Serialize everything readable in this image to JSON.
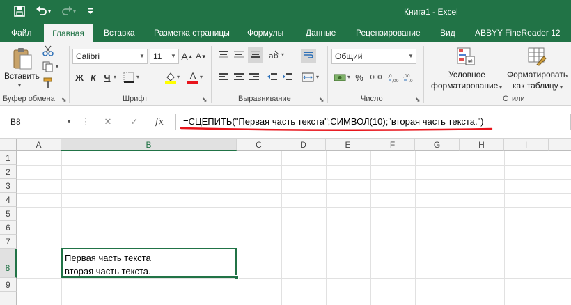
{
  "window": {
    "title": "Книга1 - Excel"
  },
  "quick_access": {
    "save_icon": "💾",
    "undo_icon": "↶",
    "redo_icon": "↷",
    "customize_icon": "▾"
  },
  "tabs": [
    {
      "label": "Файл"
    },
    {
      "label": "Главная",
      "active": true
    },
    {
      "label": "Вставка"
    },
    {
      "label": "Разметка страницы"
    },
    {
      "label": "Формулы"
    },
    {
      "label": "Данные"
    },
    {
      "label": "Рецензирование"
    },
    {
      "label": "Вид"
    },
    {
      "label": "ABBYY FineReader 12"
    }
  ],
  "ribbon": {
    "clipboard": {
      "label": "Буфер обмена",
      "paste_label": "Вставить"
    },
    "font": {
      "label": "Шрифт",
      "font_name": "Calibri",
      "font_size": "11",
      "bold": "Ж",
      "italic": "К",
      "underline": "Ч",
      "grow": "A",
      "shrink": "A",
      "font_color_letter": "A"
    },
    "alignment": {
      "label": "Выравнивание"
    },
    "number": {
      "label": "Число",
      "format": "Общий",
      "percent": "%",
      "thousands": "000"
    },
    "styles": {
      "label": "Стили",
      "conditional_line1": "Условное",
      "conditional_line2": "форматирование",
      "format_table_line1": "Форматировать",
      "format_table_line2": "как таблицу"
    }
  },
  "formula_bar": {
    "name_box": "B8",
    "fx_label": "fx",
    "formula": "=СЦЕПИТЬ(\"Первая часть текста\";СИМВОЛ(10);\"вторая часть текста.\")"
  },
  "sheet": {
    "columns": [
      "A",
      "B",
      "C",
      "D",
      "E",
      "F",
      "G",
      "H",
      "I"
    ],
    "selected_column": "B",
    "rows": [
      "1",
      "2",
      "3",
      "4",
      "5",
      "6",
      "7",
      "8",
      "9"
    ],
    "selected_row": "8",
    "active_cell": {
      "ref": "B8",
      "line1": "Первая часть текста",
      "line2": "вторая часть текста."
    }
  },
  "colors": {
    "accent": "#217346",
    "annotation": "#e8141b"
  }
}
